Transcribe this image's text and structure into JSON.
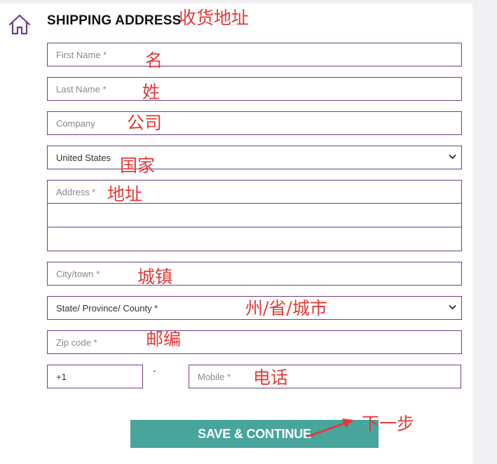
{
  "header": {
    "title": "SHIPPING ADDRESS",
    "icon": "home-icon"
  },
  "form": {
    "first_name": {
      "placeholder": "First Name *",
      "value": ""
    },
    "last_name": {
      "placeholder": "Last Name *",
      "value": ""
    },
    "company": {
      "placeholder": "Company",
      "value": ""
    },
    "country": {
      "selected": "United States"
    },
    "address_1": {
      "placeholder": "Address *",
      "value": ""
    },
    "address_2": {
      "placeholder": "",
      "value": ""
    },
    "address_3": {
      "placeholder": "",
      "value": ""
    },
    "city": {
      "placeholder": "City/town *",
      "value": ""
    },
    "state": {
      "selected": "State/ Province/ County *"
    },
    "zip": {
      "placeholder": "Zip code *",
      "value": ""
    },
    "phone_code": {
      "value": "+1"
    },
    "phone_separator": "-",
    "mobile": {
      "placeholder": "Mobile *",
      "value": ""
    }
  },
  "actions": {
    "save_label": "SAVE & CONTINUE"
  },
  "annotations": {
    "title_note": "收货地址",
    "first_name_note": "名",
    "last_name_note": "姓",
    "company_note": "公司",
    "country_note": "国家",
    "address_note": "地址",
    "city_note": "城镇",
    "state_note": "州/省/城市",
    "zip_note": "邮编",
    "mobile_note": "电话",
    "next_note": "下一步"
  },
  "colors": {
    "accent": "#6b3f83",
    "button": "#47a59b",
    "annotation": "#e13a3a"
  }
}
